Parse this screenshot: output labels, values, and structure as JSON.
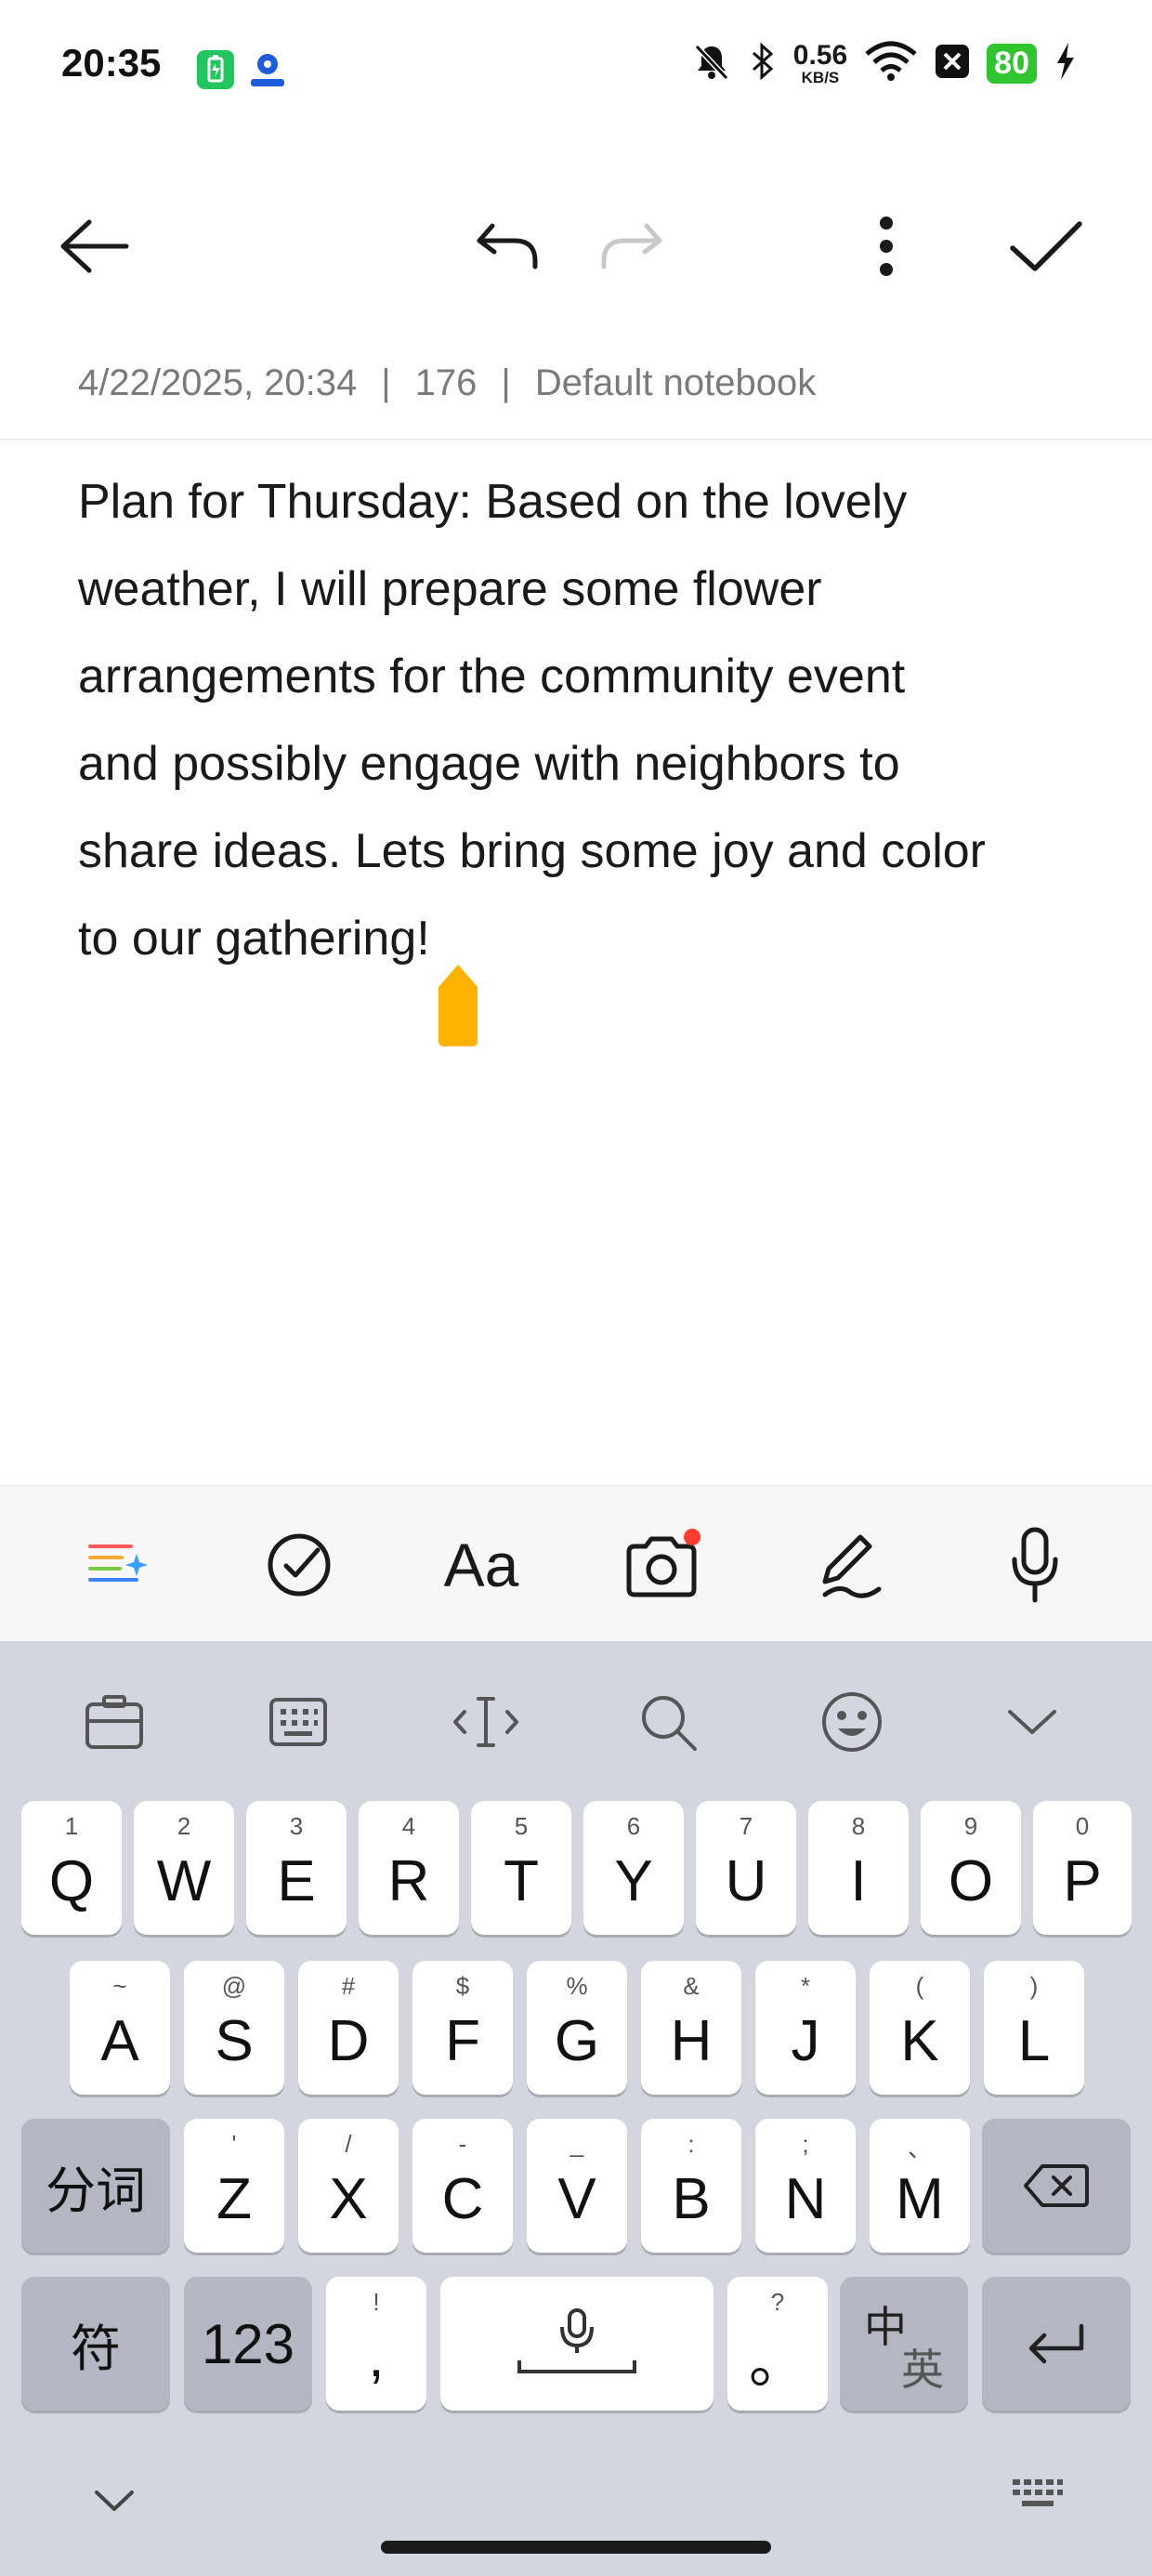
{
  "status_bar": {
    "time": "20:35",
    "net_speed_value": "0.56",
    "net_speed_unit": "KB/S",
    "battery": "80",
    "icons": [
      "battery-saver-icon",
      "location-app-icon",
      "mute-icon",
      "bluetooth-icon",
      "wifi-icon",
      "x-app-icon",
      "battery-icon",
      "charging-icon"
    ]
  },
  "toolbar": {
    "icons": [
      "back-arrow-icon",
      "undo-icon",
      "redo-icon",
      "more-vert-icon",
      "check-icon"
    ]
  },
  "meta": {
    "datetime": "4/22/2025, 20:34",
    "separator": "|",
    "count": "176",
    "notebook": "Default notebook"
  },
  "note": {
    "lines": [
      "Plan for Thursday: Based on the lovely",
      "weather, I will prepare some flower",
      "arrangements for the community event",
      "and possibly engage with neighbors to",
      "share ideas. Lets bring some joy and color",
      "to our gathering!"
    ],
    "cursor_color": "#ffb300"
  },
  "format_bar": {
    "icons": [
      "ai-sparkle-icon",
      "checklist-icon",
      "text-format-icon",
      "camera-icon",
      "handwriting-icon",
      "microphone-icon"
    ],
    "text_format_label": "Aa",
    "camera_badge_color": "#ff3b30"
  },
  "keyboard": {
    "tools": [
      "clipboard-icon",
      "keyboard-layout-icon",
      "cursor-move-icon",
      "search-icon",
      "emoji-icon",
      "collapse-icon"
    ],
    "row1": [
      {
        "k": "Q",
        "h": "1"
      },
      {
        "k": "W",
        "h": "2"
      },
      {
        "k": "E",
        "h": "3"
      },
      {
        "k": "R",
        "h": "4"
      },
      {
        "k": "T",
        "h": "5"
      },
      {
        "k": "Y",
        "h": "6"
      },
      {
        "k": "U",
        "h": "7"
      },
      {
        "k": "I",
        "h": "8"
      },
      {
        "k": "O",
        "h": "9"
      },
      {
        "k": "P",
        "h": "0"
      }
    ],
    "row2": [
      {
        "k": "A",
        "h": "~"
      },
      {
        "k": "S",
        "h": "@"
      },
      {
        "k": "D",
        "h": "#"
      },
      {
        "k": "F",
        "h": "$"
      },
      {
        "k": "G",
        "h": "%"
      },
      {
        "k": "H",
        "h": "&"
      },
      {
        "k": "J",
        "h": "*"
      },
      {
        "k": "K",
        "h": "("
      },
      {
        "k": "L",
        "h": ")"
      }
    ],
    "row3_left": "分词",
    "row3": [
      {
        "k": "Z",
        "h": "'"
      },
      {
        "k": "X",
        "h": "/"
      },
      {
        "k": "C",
        "h": "-"
      },
      {
        "k": "V",
        "h": "_"
      },
      {
        "k": "B",
        "h": ":"
      },
      {
        "k": "N",
        "h": ";"
      },
      {
        "k": "M",
        "h": "、"
      }
    ],
    "row4": {
      "symbols": "符",
      "numbers": "123",
      "comma": ",",
      "comma_hint": "!",
      "period": "。",
      "period_hint": "?",
      "lang_zh": "中",
      "lang_en": "英"
    }
  }
}
